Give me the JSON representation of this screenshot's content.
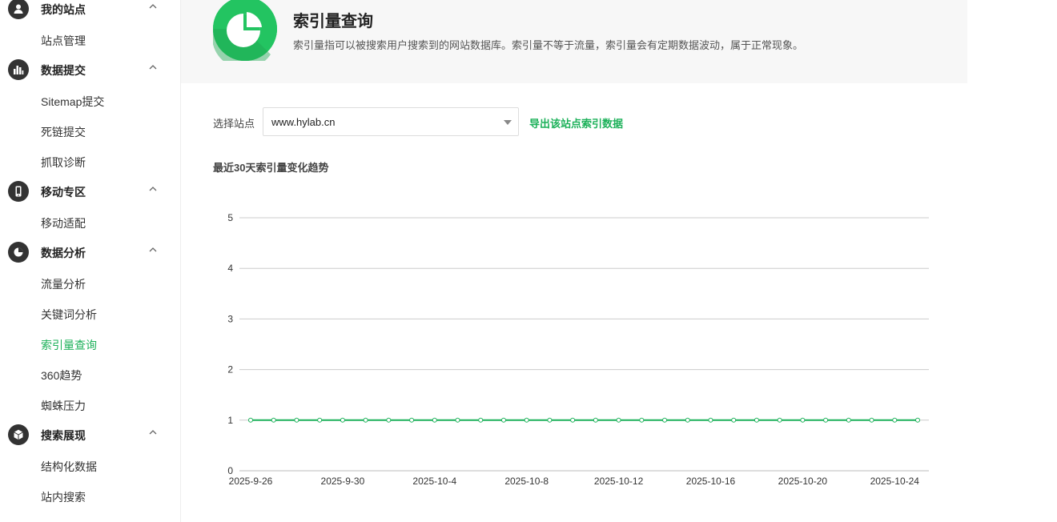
{
  "sidebar": {
    "groups": [
      {
        "title": "我的站点",
        "icon": "user-icon",
        "items": [
          "站点管理"
        ]
      },
      {
        "title": "数据提交",
        "icon": "bar-chart-icon",
        "items": [
          "Sitemap提交",
          "死链提交",
          "抓取诊断"
        ]
      },
      {
        "title": "移动专区",
        "icon": "mobile-icon",
        "items": [
          "移动适配"
        ]
      },
      {
        "title": "数据分析",
        "icon": "pie-chart-icon",
        "items": [
          "流量分析",
          "关键词分析",
          "索引量查询",
          "360趋势",
          "蜘蛛压力"
        ]
      },
      {
        "title": "搜索展现",
        "icon": "cube-icon",
        "items": [
          "结构化数据",
          "站内搜索"
        ]
      }
    ],
    "active_item": "索引量查询"
  },
  "header": {
    "title": "索引量查询",
    "description": "索引量指可以被搜索用户搜索到的网站数据库。索引量不等于流量，索引量会有定期数据波动，属于正常现象。",
    "logo_icon": "pie-chart-icon"
  },
  "controls": {
    "site_label": "选择站点",
    "site_value": "www.hylab.cn",
    "export_label": "导出该站点索引数据"
  },
  "chart_section_title": "最近30天索引量变化趋势",
  "colors": {
    "accent": "#1db15a",
    "logo": "#23c461"
  },
  "chart_data": {
    "type": "line",
    "title": "最近30天索引量变化趋势",
    "xlabel": "",
    "ylabel": "",
    "ylim": [
      0,
      5
    ],
    "yticks": [
      0,
      1,
      2,
      3,
      4,
      5
    ],
    "grid": true,
    "x": [
      "2025-9-26",
      "2025-9-27",
      "2025-9-28",
      "2025-9-29",
      "2025-9-30",
      "2025-10-1",
      "2025-10-2",
      "2025-10-3",
      "2025-10-4",
      "2025-10-5",
      "2025-10-6",
      "2025-10-7",
      "2025-10-8",
      "2025-10-9",
      "2025-10-10",
      "2025-10-11",
      "2025-10-12",
      "2025-10-13",
      "2025-10-14",
      "2025-10-15",
      "2025-10-16",
      "2025-10-17",
      "2025-10-18",
      "2025-10-19",
      "2025-10-20",
      "2025-10-21",
      "2025-10-22",
      "2025-10-23",
      "2025-10-24",
      "2025-10-25"
    ],
    "x_tick_labels": [
      "2025-9-26",
      "2025-9-30",
      "2025-10-4",
      "2025-10-8",
      "2025-10-12",
      "2025-10-16",
      "2025-10-20",
      "2025-10-24"
    ],
    "series": [
      {
        "values": [
          1,
          1,
          1,
          1,
          1,
          1,
          1,
          1,
          1,
          1,
          1,
          1,
          1,
          1,
          1,
          1,
          1,
          1,
          1,
          1,
          1,
          1,
          1,
          1,
          1,
          1,
          1,
          1,
          1,
          1
        ],
        "color": "#1db15a"
      }
    ]
  }
}
